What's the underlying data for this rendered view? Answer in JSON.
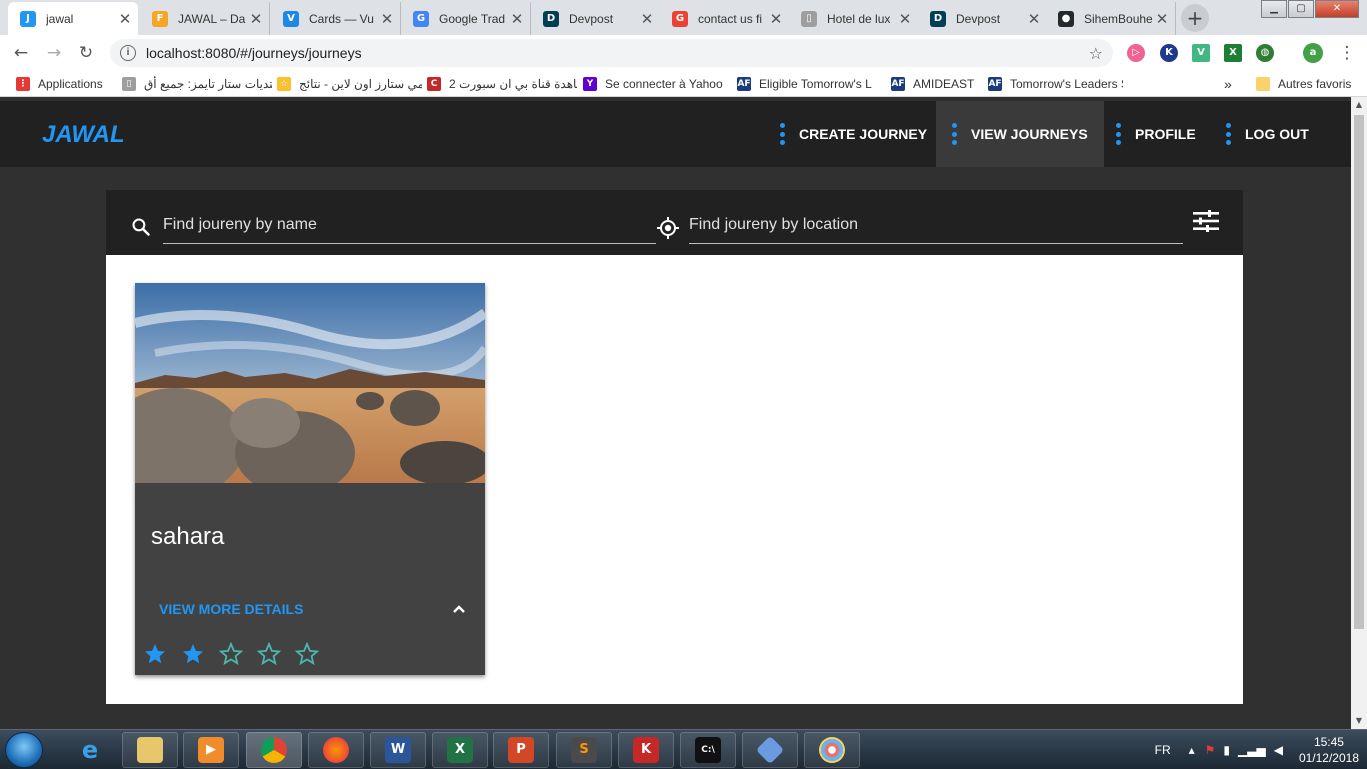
{
  "browser": {
    "tabs": [
      {
        "title": "jawal",
        "icon": "jawal-favicon",
        "color": "#2196f3",
        "glyph": "J"
      },
      {
        "title": "JAWAL – Da",
        "icon": "firebase-favicon",
        "color": "#f5a623",
        "glyph": "F"
      },
      {
        "title": "Cards — Vu",
        "icon": "vuetify-favicon",
        "color": "#1e88e5",
        "glyph": "V"
      },
      {
        "title": "Google Trad",
        "icon": "google-translate-favicon",
        "color": "#4285f4",
        "glyph": "G"
      },
      {
        "title": "Devpost",
        "icon": "devpost-favicon",
        "color": "#003e54",
        "glyph": "D"
      },
      {
        "title": "contact us fi",
        "icon": "google-favicon",
        "color": "#ea4335",
        "glyph": "G"
      },
      {
        "title": "Hotel de lux",
        "icon": "page-favicon",
        "color": "#9e9e9e",
        "glyph": "▯"
      },
      {
        "title": "Devpost",
        "icon": "devpost-favicon",
        "color": "#003e54",
        "glyph": "D"
      },
      {
        "title": "SihemBouhe",
        "icon": "github-favicon",
        "color": "#24292e",
        "glyph": "●"
      }
    ],
    "new_tab": "+",
    "url": "localhost:8080/#/journeys/journeys",
    "bookmarks": [
      {
        "label": "Applications",
        "color": "#e53935",
        "glyph": "⋮"
      },
      {
        "label": "منتديات ستار تايمز: جميع أق",
        "color": "#9e9e9e",
        "glyph": "▯"
      },
      {
        "label": "انمي ستارز اون لاين - نتائج",
        "color": "#fbc02d",
        "glyph": "☆"
      },
      {
        "label": "مشاهدة قناة بي ان سبورت 2",
        "color": "#c62828",
        "glyph": "C"
      },
      {
        "label": "Se connecter à Yahoo",
        "color": "#5f01d1",
        "glyph": "Y"
      },
      {
        "label": "Eligible Tomorrow's L",
        "color": "#1a3c7a",
        "glyph": "AF"
      },
      {
        "label": "AMIDEAST",
        "color": "#1a3c7a",
        "glyph": "AF"
      },
      {
        "label": "Tomorrow's Leaders S",
        "color": "#1a3c7a",
        "glyph": "AF"
      }
    ],
    "more_bookmarks": "»",
    "other_bookmarks": "Autres favoris",
    "profile_initial": "a"
  },
  "app": {
    "logo": "JAWAL",
    "nav": [
      {
        "label": "CREATE JOURNEY",
        "active": false
      },
      {
        "label": "VIEW JOURNEYS",
        "active": true
      },
      {
        "label": "PROFILE",
        "active": false
      },
      {
        "label": "LOG OUT",
        "active": false
      }
    ],
    "search": {
      "name_placeholder": "Find joureny by name",
      "location_placeholder": "Find joureny by location"
    },
    "journeys": [
      {
        "title": "sahara",
        "action": "VIEW MORE DETAILS",
        "rating": 2,
        "max_rating": 5
      }
    ],
    "colors": {
      "accent": "#2196f3",
      "header": "#212121",
      "card": "#424242",
      "star_empty": "#4db6ac"
    }
  },
  "taskbar": {
    "language": "FR",
    "time": "15:45",
    "date": "01/12/2018"
  }
}
